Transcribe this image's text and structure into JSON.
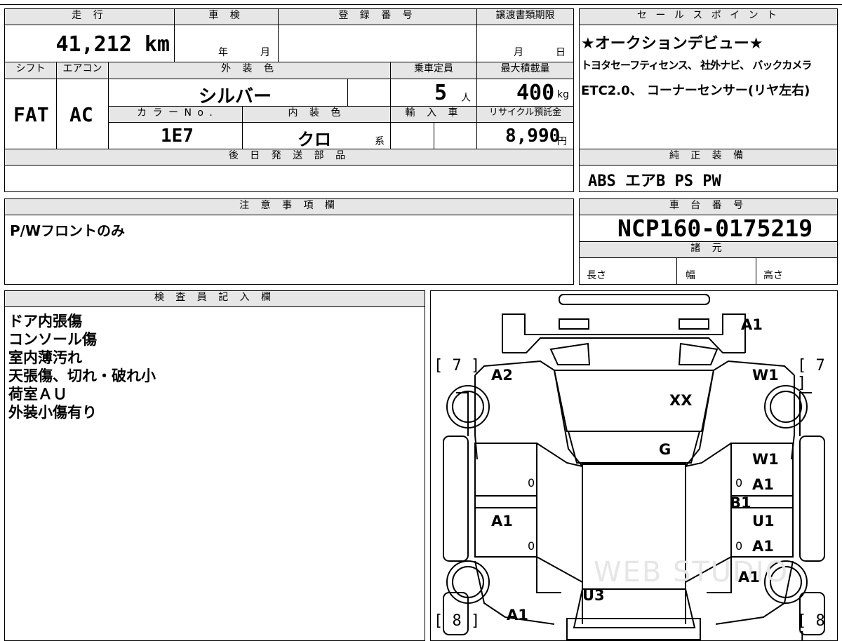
{
  "top": {
    "mileage_header": "走 行",
    "mileage_value": "41,212 km",
    "inspection_header": "車 検",
    "inspection_year": "年",
    "inspection_month": "月",
    "registration_header": "登 録 番 号",
    "transfer_header": "譲渡書類期限",
    "transfer_month": "月",
    "transfer_day": "日"
  },
  "row2": {
    "shift_header": "シフト",
    "ac_header": "エアコン",
    "color_header": "外 装 色",
    "capacity_header": "乗車定員",
    "load_header": "最大積載量",
    "shift_value": "FAT",
    "ac_value": "AC",
    "color_value": "シルバー",
    "capacity_value": "5",
    "capacity_unit": "人",
    "load_value": "400",
    "load_unit": "kg",
    "colorno_header": "カ ラ ー N o .",
    "interior_header": "内 装 色",
    "import_header": "輸 入 車",
    "recycle_header": "リサイクル預託金",
    "colorno_value": "1E7",
    "interior_value": "クロ",
    "interior_suffix": "系",
    "recycle_value": "8,990",
    "recycle_unit": "円",
    "later_parts_header": "後 日 発 送 部 品"
  },
  "sales": {
    "header": "セ ー ル ス ポ イ ン ト",
    "lines": [
      "★オークションデビュー★",
      "トヨタセーフティセンス、 社外ナビ、 バックカメラ",
      "ETC2.0、 コーナーセンサー(リヤ左右)"
    ]
  },
  "genuine": {
    "header": "純 正 装 備",
    "value": "ABS エアB PS PW"
  },
  "notes": {
    "header": "注 意 事 項 欄",
    "value": "P/Wフロントのみ"
  },
  "chassis": {
    "header": "車 台 番 号",
    "value": "NCP160-0175219",
    "spec_header": "諸 元",
    "length_label": "長さ",
    "width_label": "幅",
    "height_label": "高さ"
  },
  "inspector": {
    "header": "検 査 員 記 入 欄",
    "lines": [
      "ドア内張傷",
      "コンソール傷",
      "室内薄汚れ",
      "天張傷、切れ・破れ小",
      "荷室ＡＵ",
      "外装小傷有り"
    ]
  },
  "diagram": {
    "front_bumper": "A1",
    "front_left_tire": "[ 7 ]",
    "front_right_tire": "[ 7 ]",
    "rear_left_tire": "[ 8 ]",
    "rear_right_tire": "[ 8 ]",
    "left_front_fender": "A2",
    "right_front_fender": "W1",
    "hood": "XX",
    "windshield": "G",
    "right_front_door_1": "W1",
    "right_front_door_2": "A1",
    "right_sill": "B1",
    "right_rear_door_1": "U1",
    "right_rear_door_2": "A1",
    "left_rear_door": "A1",
    "right_rear_fender": "A1",
    "rear_window": "U3",
    "rear_bumper": "A1",
    "zero_label": "0",
    "watermark": "WEB STUDIO"
  }
}
